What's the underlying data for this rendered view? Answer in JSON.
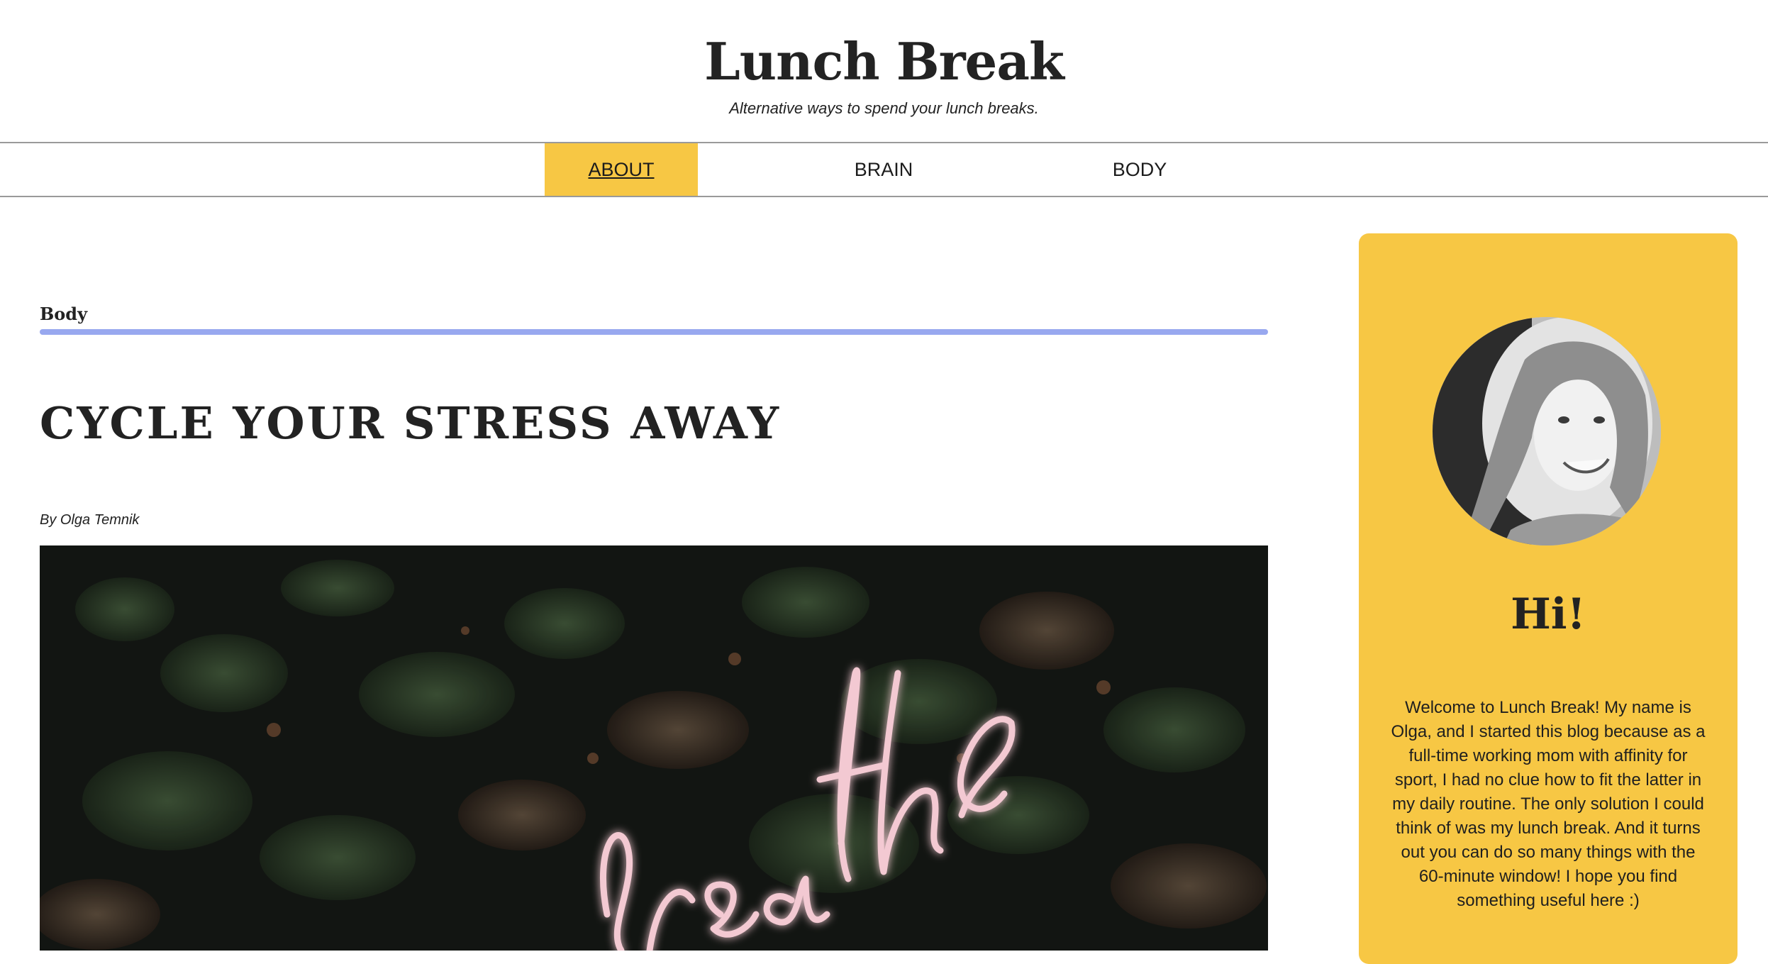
{
  "header": {
    "site_title": "Lunch Break",
    "tagline": "Alternative ways to spend your lunch breaks."
  },
  "nav": {
    "items": [
      {
        "label": "ABOUT",
        "active": true
      },
      {
        "label": "BRAIN",
        "active": false
      },
      {
        "label": "BODY",
        "active": false
      }
    ]
  },
  "post": {
    "category": "Body",
    "title": "CYCLE YOUR STRESS AWAY",
    "byline": "By Olga Temnik",
    "hero_image_text": "breathe"
  },
  "sidebar": {
    "greeting": "Hi!",
    "bio": "Welcome to Lunch Break! My name is Olga, and I started this blog because as a full-time working mom with affinity for sport, I had no clue how to fit the latter in my daily routine. The only solution I could think of was my lunch break. And it turns out you can do so many things with the 60-minute window! I hope you find something useful here :)"
  },
  "colors": {
    "accent": "#f7c744",
    "category_rule": "#98a8ef",
    "text": "#222222"
  }
}
